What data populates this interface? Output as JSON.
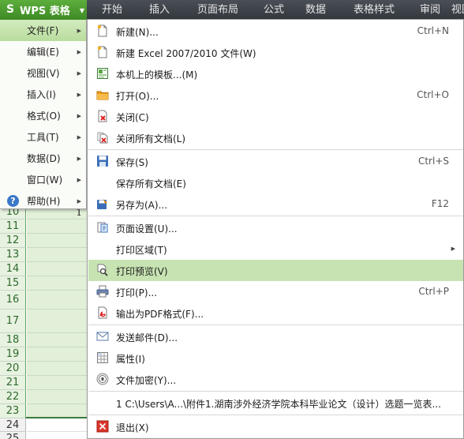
{
  "app": {
    "logo": "S",
    "name": "WPS 表格"
  },
  "ribbon_tabs": [
    "开始",
    "插入",
    "页面布局",
    "公式",
    "数据",
    "表格样式",
    "审阅",
    "视图"
  ],
  "app_menu": [
    {
      "label": "文件(F)",
      "active": true
    },
    {
      "label": "编辑(E)"
    },
    {
      "label": "视图(V)"
    },
    {
      "label": "插入(I)"
    },
    {
      "label": "格式(O)"
    },
    {
      "label": "工具(T)"
    },
    {
      "label": "数据(D)"
    },
    {
      "label": "窗口(W)"
    },
    {
      "label": "帮助(H)",
      "icon": "help-icon"
    }
  ],
  "sheet": {
    "rows": [
      "10",
      "11",
      "12",
      "13",
      "14",
      "15",
      "16",
      "17",
      "18",
      "19",
      "20",
      "21",
      "22",
      "23",
      "24",
      "25"
    ],
    "cell_value": "1"
  },
  "file_menu": {
    "groups": [
      [
        {
          "label": "新建(N)...",
          "shortcut": "Ctrl+N",
          "icon": "new-doc-icon"
        },
        {
          "label": "新建 Excel 2007/2010 文件(W)",
          "icon": "new-doc-icon"
        },
        {
          "label": "本机上的模板...(M)",
          "icon": "template-icon"
        },
        {
          "label": "打开(O)...",
          "shortcut": "Ctrl+O",
          "icon": "open-folder-icon"
        },
        {
          "label": "关闭(C)",
          "icon": "close-doc-icon"
        },
        {
          "label": "关闭所有文档(L)",
          "icon": "close-all-icon"
        }
      ],
      [
        {
          "label": "保存(S)",
          "shortcut": "Ctrl+S",
          "icon": "save-icon"
        },
        {
          "label": "保存所有文档(E)"
        },
        {
          "label": "另存为(A)...",
          "shortcut": "F12",
          "icon": "save-as-icon"
        }
      ],
      [
        {
          "label": "页面设置(U)...",
          "icon": "page-setup-icon"
        },
        {
          "label": "打印区域(T)",
          "submenu": true
        },
        {
          "label": "打印预览(V)",
          "icon": "print-preview-icon",
          "highlighted": true
        },
        {
          "label": "打印(P)...",
          "shortcut": "Ctrl+P",
          "icon": "printer-icon"
        },
        {
          "label": "输出为PDF格式(F)...",
          "icon": "pdf-icon"
        }
      ],
      [
        {
          "label": "发送邮件(D)...",
          "icon": "mail-icon"
        },
        {
          "label": "属性(I)",
          "icon": "properties-icon"
        },
        {
          "label": "文件加密(Y)...",
          "icon": "lock-icon"
        }
      ],
      [
        {
          "label": "1 C:\\Users\\A...\\附件1.湖南涉外经济学院本科毕业论文（设计）选题一览表..."
        }
      ],
      [
        {
          "label": "退出(X)",
          "icon": "exit-icon"
        }
      ]
    ]
  },
  "colors": {
    "accent_green": "#4a9a2e",
    "highlight": "#c7e3b2",
    "titlebar": "#3c4047"
  }
}
